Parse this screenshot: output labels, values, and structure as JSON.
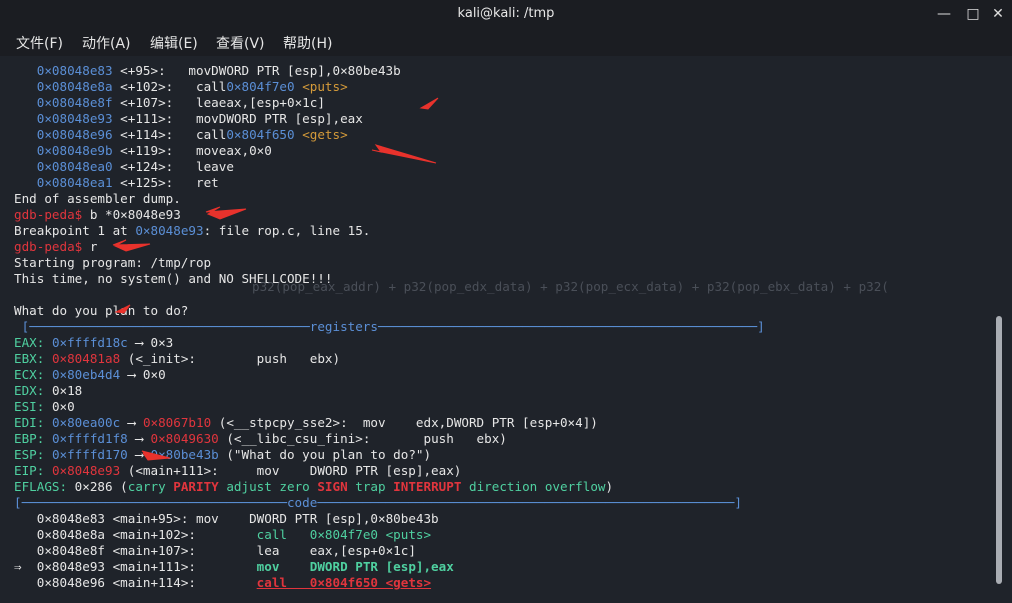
{
  "window": {
    "title": "kali@kali: /tmp",
    "btn_min": "—",
    "btn_max": "□",
    "btn_close": "✕"
  },
  "menu": [
    "文件(F)",
    "动作(A)",
    "编辑(E)",
    "查看(V)",
    "帮助(H)"
  ],
  "asm": [
    {
      "addr": "0×08048e83",
      "off": "<+95>:",
      "op": "mov",
      "args": "DWORD PTR [esp],0×80be43b",
      "tgt": "",
      "sym": ""
    },
    {
      "addr": "0×08048e8a",
      "off": "<+102>:",
      "op": "call",
      "args": "",
      "tgt": "0×804f7e0",
      "sym": "<puts>"
    },
    {
      "addr": "0×08048e8f",
      "off": "<+107>:",
      "op": "lea",
      "args": "eax,[esp+0×1c]",
      "tgt": "",
      "sym": ""
    },
    {
      "addr": "0×08048e93",
      "off": "<+111>:",
      "op": "mov",
      "args": "DWORD PTR [esp],eax",
      "tgt": "",
      "sym": ""
    },
    {
      "addr": "0×08048e96",
      "off": "<+114>:",
      "op": "call",
      "args": "",
      "tgt": "0×804f650",
      "sym": "<gets>"
    },
    {
      "addr": "0×08048e9b",
      "off": "<+119>:",
      "op": "mov",
      "args": "eax,0×0",
      "tgt": "",
      "sym": ""
    },
    {
      "addr": "0×08048ea0",
      "off": "<+124>:",
      "op": "leave",
      "args": "",
      "tgt": "",
      "sym": ""
    },
    {
      "addr": "0×08048ea1",
      "off": "<+125>:",
      "op": "ret",
      "args": "",
      "tgt": "",
      "sym": ""
    }
  ],
  "end_dump": "End of assembler dump.",
  "prompt": "gdb-peda$",
  "cmd_break": " b *0×8048e93",
  "bp_prefix": "Breakpoint 1 at ",
  "bp_addr": "0×8048e93",
  "bp_suffix": ": file rop.c, line 15.",
  "cmd_run": " r",
  "starting": "Starting program: /tmp/rop",
  "msg1": "This time, no system() and NO SHELLCODE!!!",
  "ghost_text": "p32(pop_eax_addr) + p32(pop_edx_data) + p32(pop_ecx_data) + p32(pop_ebx_data) + p32(",
  "msg2": "What do you plan to do?",
  "reg_header_left": "[",
  "reg_header_dash1": "─────────────────────────────────────",
  "reg_header_name": "registers",
  "reg_header_dash2": "──────────────────────────────────────────────────",
  "reg_header_right": "]",
  "regs": {
    "eax": {
      "label": "EAX:",
      "val": "0×ffffd18c",
      "rest": " ⟶ 0×3"
    },
    "ebx": {
      "label": "EBX:",
      "val": "0×80481a8",
      "rest": " (<_init>:        push   ebx)"
    },
    "ecx": {
      "label": "ECX:",
      "val": "0×80eb4d4",
      "rest": " ⟶ 0×0"
    },
    "edx": {
      "label": "EDX:",
      "val": "0×18"
    },
    "esi": {
      "label": "ESI:",
      "val": "0×0"
    },
    "edi": {
      "label": "EDI:",
      "val": "0×80ea00c",
      "arrow": " ⟶ ",
      "val2": "0×8067b10",
      "rest": " (<__stpcpy_sse2>:  mov    edx,DWORD PTR [esp+0×4])"
    },
    "ebp": {
      "label": "EBP:",
      "val": "0×ffffd1f8",
      "arrow": " ⟶ ",
      "val2": "0×8049630",
      "rest": " (<__libc_csu_fini>:       push   ebx)"
    },
    "esp": {
      "label": "ESP:",
      "val": "0×ffffd170",
      "arrow": " ⟶ ",
      "val2": "0×80be43b",
      "rest": " (\"What do you plan to do?\")"
    },
    "eip": {
      "label": "EIP:",
      "val": "0×8048e93",
      "rest": " (<main+111>:     mov    DWORD PTR [esp],eax)"
    }
  },
  "eflags": {
    "label": "EFLAGS:",
    "val": " 0×286 (",
    "carry": "carry ",
    "parity": "PARITY",
    "adjust": " adjust zero ",
    "sign": "SIGN",
    "trap": " trap ",
    "interrupt": "INTERRUPT",
    "rest": " direction overflow",
    "close": ")"
  },
  "code_header_left": "[",
  "code_header_dash1": "───────────────────────────────────",
  "code_header_name": "code",
  "code_header_dash2": "───────────────────────────────────────────────────────",
  "code_header_right": "]",
  "code": [
    {
      "pre": "   ",
      "addr": "0×8048e83",
      "loc": "<main+95>:",
      "pad": " ",
      "ins": "mov    DWORD PTR [esp],0×80be43b"
    },
    {
      "pre": "   ",
      "addr": "0×8048e8a",
      "loc": "<main+102>:",
      "pad": "        ",
      "ins": "call   0×804f7e0 <puts>"
    },
    {
      "pre": "   ",
      "addr": "0×8048e8f",
      "loc": "<main+107>:",
      "pad": "        ",
      "ins": "lea    eax,[esp+0×1c]"
    },
    {
      "pre": "⇒  ",
      "addr": "0×8048e93",
      "loc": "<main+111>:",
      "pad": "        ",
      "ins": "mov    DWORD PTR [esp],eax"
    },
    {
      "pre": "   ",
      "addr": "0×8048e96",
      "loc": "<main+114>:",
      "pad": "        ",
      "ins": "call   0×804f650 <gets>"
    }
  ],
  "colors": {
    "accent_blue": "#5b8fd6",
    "accent_red": "#e0353d",
    "accent_green": "#4fd0a0",
    "accent_gold": "#d59b3a",
    "bg": "#1f232a"
  }
}
